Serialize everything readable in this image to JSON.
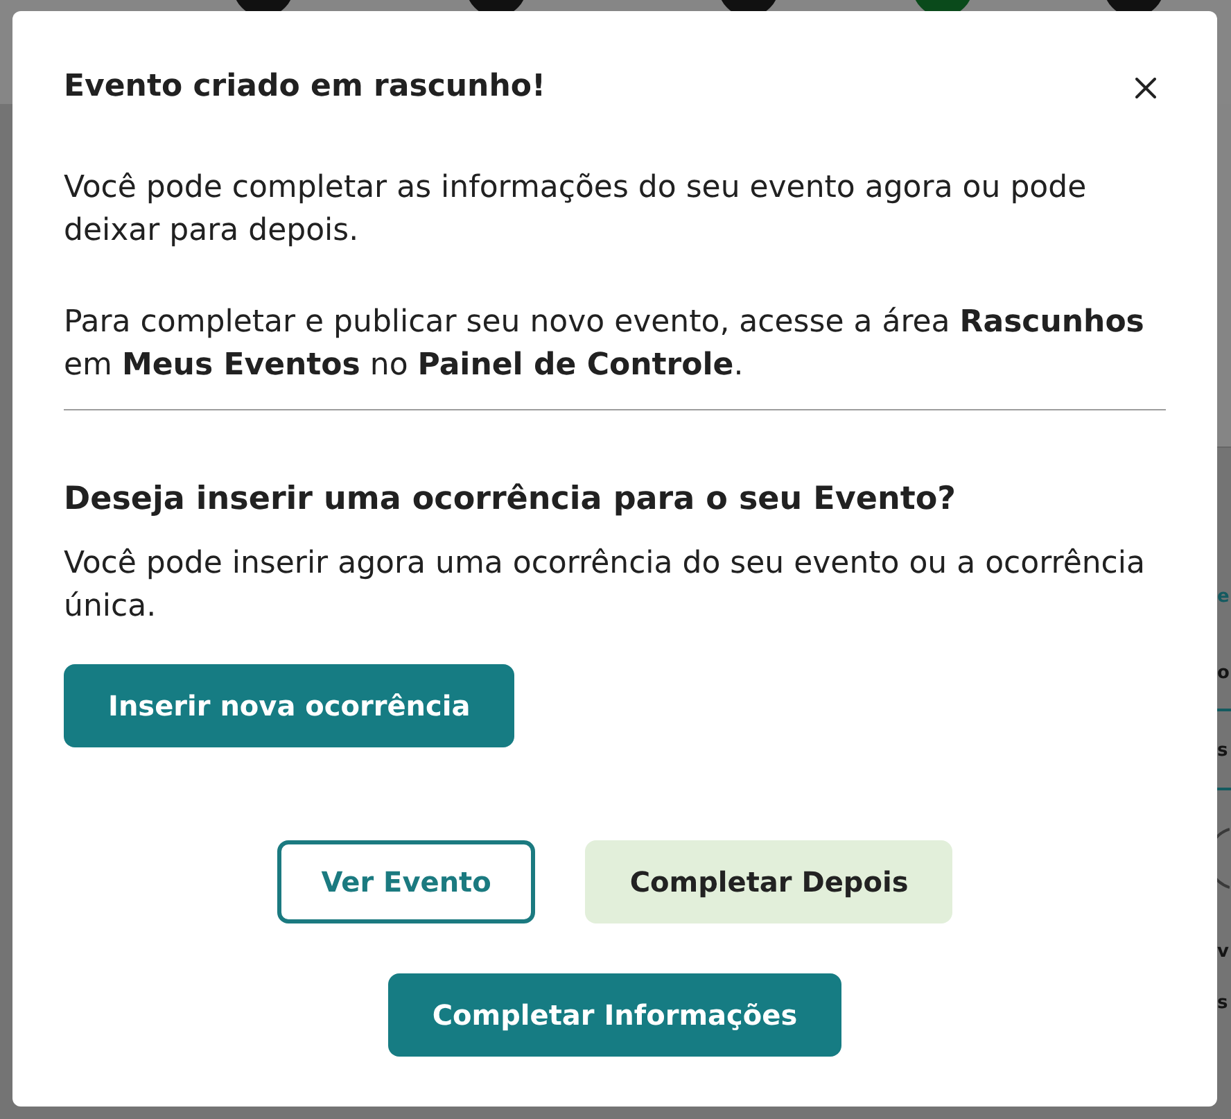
{
  "background": {
    "stepper": [
      {
        "active": false
      },
      {
        "active": false
      },
      {
        "active": false
      },
      {
        "active": true
      },
      {
        "active": false
      }
    ],
    "fragments": [
      {
        "text": "e",
        "color": "#155a60"
      },
      {
        "text": "o",
        "color": "#151515"
      },
      {
        "text": "s",
        "color": "#151515"
      },
      {
        "text": "v",
        "color": "#151515"
      },
      {
        "text": "s",
        "color": "#151515"
      }
    ]
  },
  "dialog": {
    "title": "Evento criado em rascunho!",
    "paragraphs": [
      "Você pode completar as informações do seu evento agora ou pode deixar para depois.",
      "Para completar e publicar seu novo evento, acesse a área **Rascunhos** em **Meus Eventos** no **Painel de Controle**."
    ],
    "section": {
      "heading": "Deseja inserir uma ocorrência para o seu Evento?",
      "text": "Você pode inserir agora uma ocorrência do seu evento ou a ocorrência única.",
      "button": {
        "label": "Inserir nova ocorrência",
        "kind": "primary"
      }
    },
    "actions": [
      {
        "label": "Ver Evento",
        "kind": "outline"
      },
      {
        "label": "Completar Depois",
        "kind": "soft"
      },
      {
        "label": "Completar Informações",
        "kind": "primary"
      }
    ]
  }
}
